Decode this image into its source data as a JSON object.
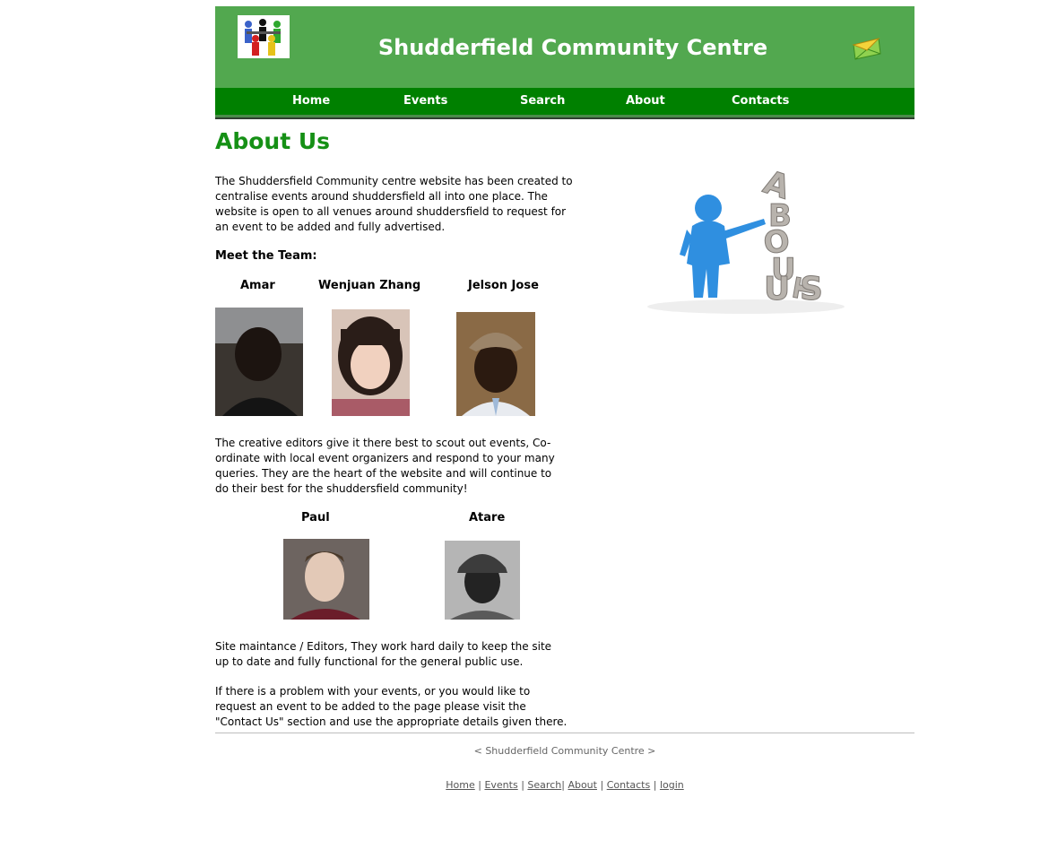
{
  "header": {
    "title": "Shudderfield Community Centre",
    "logo_icon": "community-people-logo",
    "mail_icon": "envelope-icon"
  },
  "nav": {
    "items": [
      "Home",
      "Events",
      "Search",
      "About",
      "Contacts"
    ]
  },
  "page": {
    "title": "About Us",
    "intro": "The Shuddersfield Community centre website has been created to centralise events around shuddersfield all into one place. The website is open to all venues around shuddersfield to request for an event to be added and fully advertised.",
    "meet_team": "Meet the Team:",
    "team1": [
      "Amar",
      "Wenjuan Zhang",
      "Jelson Jose"
    ],
    "creative_text": "The creative editors give it there best to scout out events, Co-ordinate with local event organizers and respond to your many queries. They are the heart of the website and will continue to do their best for the shuddersfield community!",
    "team2": [
      "Paul",
      "Atare"
    ],
    "maintenance_text": "Site maintance / Editors, They work hard daily to keep the site up to date and fully functional for the general public use.",
    "problem_text": "If there is a problem with your events, or you would like to request an event to be added to the page please visit the \"Contact Us\" section and use the appropriate details given there."
  },
  "footer": {
    "center": "< Shudderfield Community Centre >",
    "links": [
      "Home",
      "Events",
      "Search",
      "About",
      "Contacts",
      "login"
    ],
    "separator": "|"
  },
  "colors": {
    "header_green": "#52a84f",
    "nav_green": "#008000",
    "title_green": "#159015"
  }
}
